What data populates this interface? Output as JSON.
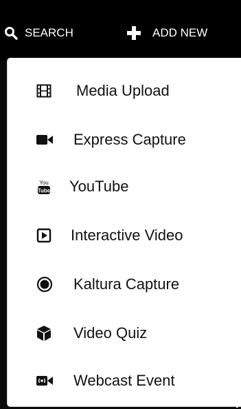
{
  "topbar": {
    "search_label": "SEARCH",
    "search_icon": "search-icon",
    "add_new_label": "ADD NEW",
    "add_new_icon": "plus-icon"
  },
  "menu": {
    "items": [
      {
        "label": "Media Upload",
        "icon": "film-icon"
      },
      {
        "label": "Express Capture",
        "icon": "video-camera-icon"
      },
      {
        "label": "YouTube",
        "icon": "youtube-icon"
      },
      {
        "label": "Interactive Video",
        "icon": "play-square-icon"
      },
      {
        "label": "Kaltura Capture",
        "icon": "record-icon"
      },
      {
        "label": "Video Quiz",
        "icon": "cube-icon"
      },
      {
        "label": "Webcast Event",
        "icon": "webcast-icon"
      }
    ]
  },
  "colors": {
    "topbar_bg": "#000000",
    "menu_bg": "#ffffff",
    "text_dark": "#111111",
    "text_light": "#ffffff"
  }
}
